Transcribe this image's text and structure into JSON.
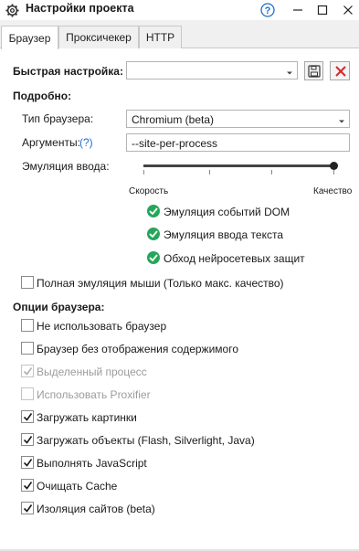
{
  "window": {
    "title": "Настройки проекта",
    "icons": {
      "settings": "gear-icon",
      "help": "help-icon",
      "minimize": "minimize-icon",
      "maximize": "maximize-icon",
      "close": "close-icon"
    }
  },
  "tabs": [
    {
      "label": "Браузер",
      "active": true
    },
    {
      "label": "Проксичекер",
      "active": false
    },
    {
      "label": "HTTP",
      "active": false
    }
  ],
  "quick": {
    "label": "Быстрая настройка:",
    "value": ""
  },
  "details": {
    "heading": "Подробно:",
    "browser_type_label": "Тип браузера:",
    "browser_type_value": "Chromium (beta)",
    "args_label": "Аргументы:",
    "args_help": "(?)",
    "args_value": "--site-per-process",
    "input_emulation_label": "Эмуляция ввода:",
    "slider_min_label": "Скорость",
    "slider_max_label": "Качество",
    "slider_level": 1.0,
    "features": [
      "Эмуляция событий DOM",
      "Эмуляция ввода текста",
      "Обход нейросетевых защит"
    ],
    "full_mouse_label": "Полная эмуляция мыши (Только макс. качество)",
    "full_mouse_checked": false
  },
  "browser_options": {
    "heading": "Опции браузера:",
    "items": [
      {
        "label": "Не использовать браузер",
        "checked": false,
        "disabled": false
      },
      {
        "label": "Браузер без отображения содержимого",
        "checked": false,
        "disabled": false
      },
      {
        "label": "Выделенный процесс",
        "checked": true,
        "disabled": true
      },
      {
        "label": "Использовать Proxifier",
        "checked": false,
        "disabled": true
      },
      {
        "label": "Загружать картинки",
        "checked": true,
        "disabled": false
      },
      {
        "label": "Загружать объекты (Flash, Silverlight, Java)",
        "checked": true,
        "disabled": false
      },
      {
        "label": "Выполнять JavaScript",
        "checked": true,
        "disabled": false
      },
      {
        "label": "Очищать Cache",
        "checked": true,
        "disabled": false
      },
      {
        "label": "Изоляция сайтов (beta)",
        "checked": true,
        "disabled": false
      }
    ]
  },
  "colors": {
    "accent_blue": "#1f6fd1",
    "feature_green": "#26a65b",
    "delete_red": "#d42a2a"
  }
}
